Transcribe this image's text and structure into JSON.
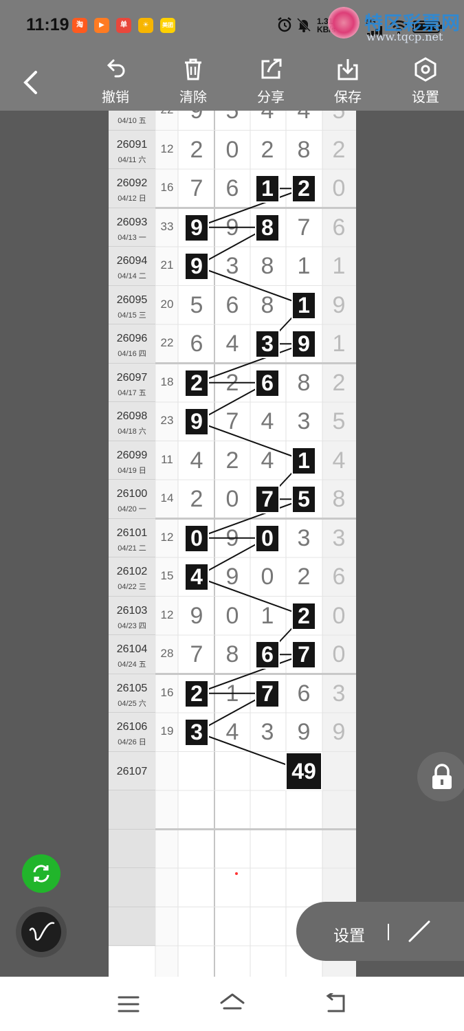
{
  "status_bar": {
    "time": "11:19",
    "app_icons": [
      {
        "name": "taobao-icon",
        "label": "淘",
        "color": "#ff5a1f"
      },
      {
        "name": "video-app-icon",
        "label": "▶",
        "color": "#ff7b22"
      },
      {
        "name": "calendar-app-icon",
        "label": "单",
        "color": "#e8473c"
      },
      {
        "name": "photo-app-icon",
        "label": "☀",
        "color": "#f7b500"
      },
      {
        "name": "meituan-icon",
        "label": "美团",
        "color": "#ffd100"
      }
    ],
    "speed_value": "1.31",
    "speed_unit": "KB/s",
    "network": "5G"
  },
  "watermark": {
    "text": "特区彩票网",
    "url": "www.tqcp.net"
  },
  "toolbar": {
    "undo_label": "撤销",
    "clear_label": "清除",
    "share_label": "分享",
    "save_label": "保存",
    "settings_label": "设置"
  },
  "rows": [
    {
      "issue": "",
      "date": "04/10 五",
      "sum": "22",
      "digits": [
        "9",
        "5",
        "4",
        "4",
        "5"
      ]
    },
    {
      "issue": "26091",
      "date": "04/11 六",
      "sum": "12",
      "digits": [
        "2",
        "0",
        "2",
        "8",
        "2"
      ]
    },
    {
      "issue": "26092",
      "date": "04/12 日",
      "sum": "16",
      "digits": [
        "7",
        "6",
        "1",
        "2",
        "0"
      ]
    },
    {
      "issue": "26093",
      "date": "04/13 一",
      "sum": "33",
      "digits": [
        "9",
        "9",
        "8",
        "7",
        "6"
      ]
    },
    {
      "issue": "26094",
      "date": "04/14 二",
      "sum": "21",
      "digits": [
        "9",
        "3",
        "8",
        "1",
        "1"
      ]
    },
    {
      "issue": "26095",
      "date": "04/15 三",
      "sum": "20",
      "digits": [
        "5",
        "6",
        "8",
        "1",
        "9"
      ]
    },
    {
      "issue": "26096",
      "date": "04/16 四",
      "sum": "22",
      "digits": [
        "6",
        "4",
        "3",
        "9",
        "1"
      ]
    },
    {
      "issue": "26097",
      "date": "04/17 五",
      "sum": "18",
      "digits": [
        "2",
        "2",
        "6",
        "8",
        "2"
      ]
    },
    {
      "issue": "26098",
      "date": "04/18 六",
      "sum": "23",
      "digits": [
        "9",
        "7",
        "4",
        "3",
        "5"
      ]
    },
    {
      "issue": "26099",
      "date": "04/19 日",
      "sum": "11",
      "digits": [
        "4",
        "2",
        "4",
        "1",
        "4"
      ]
    },
    {
      "issue": "26100",
      "date": "04/20 一",
      "sum": "14",
      "digits": [
        "2",
        "0",
        "7",
        "5",
        "8"
      ]
    },
    {
      "issue": "26101",
      "date": "04/21 二",
      "sum": "12",
      "digits": [
        "0",
        "9",
        "0",
        "3",
        "3"
      ]
    },
    {
      "issue": "26102",
      "date": "04/22 三",
      "sum": "15",
      "digits": [
        "4",
        "9",
        "0",
        "2",
        "6"
      ]
    },
    {
      "issue": "26103",
      "date": "04/23 四",
      "sum": "12",
      "digits": [
        "9",
        "0",
        "1",
        "2",
        "0"
      ]
    },
    {
      "issue": "26104",
      "date": "04/24 五",
      "sum": "28",
      "digits": [
        "7",
        "8",
        "6",
        "7",
        "0"
      ]
    },
    {
      "issue": "26105",
      "date": "04/25 六",
      "sum": "16",
      "digits": [
        "2",
        "1",
        "7",
        "6",
        "3"
      ]
    },
    {
      "issue": "26106",
      "date": "04/26 日",
      "sum": "19",
      "digits": [
        "3",
        "4",
        "3",
        "9",
        "9"
      ]
    },
    {
      "issue": "26107",
      "date": "",
      "sum": "",
      "digits": [
        "",
        "",
        "",
        "",
        ""
      ]
    }
  ],
  "highlights": [
    {
      "row": 2,
      "col": 2,
      "text": "1"
    },
    {
      "row": 2,
      "col": 3,
      "text": "2"
    },
    {
      "row": 3,
      "col": 0,
      "text": "9"
    },
    {
      "row": 3,
      "col": 2,
      "text": "8"
    },
    {
      "row": 4,
      "col": 0,
      "text": "9"
    },
    {
      "row": 5,
      "col": 3,
      "text": "1"
    },
    {
      "row": 6,
      "col": 2,
      "text": "3"
    },
    {
      "row": 6,
      "col": 3,
      "text": "9"
    },
    {
      "row": 7,
      "col": 0,
      "text": "2"
    },
    {
      "row": 7,
      "col": 2,
      "text": "6"
    },
    {
      "row": 8,
      "col": 0,
      "text": "9"
    },
    {
      "row": 9,
      "col": 3,
      "text": "1"
    },
    {
      "row": 10,
      "col": 2,
      "text": "7"
    },
    {
      "row": 10,
      "col": 3,
      "text": "5"
    },
    {
      "row": 11,
      "col": 0,
      "text": "0"
    },
    {
      "row": 11,
      "col": 2,
      "text": "0"
    },
    {
      "row": 12,
      "col": 0,
      "text": "4"
    },
    {
      "row": 13,
      "col": 3,
      "text": "2"
    },
    {
      "row": 14,
      "col": 2,
      "text": "6"
    },
    {
      "row": 14,
      "col": 3,
      "text": "7"
    },
    {
      "row": 15,
      "col": 0,
      "text": "2"
    },
    {
      "row": 15,
      "col": 2,
      "text": "7"
    },
    {
      "row": 16,
      "col": 0,
      "text": "3"
    }
  ],
  "prediction": {
    "row": 17,
    "col": 3,
    "text": "49"
  },
  "floating": {
    "pill_label": "设置"
  }
}
